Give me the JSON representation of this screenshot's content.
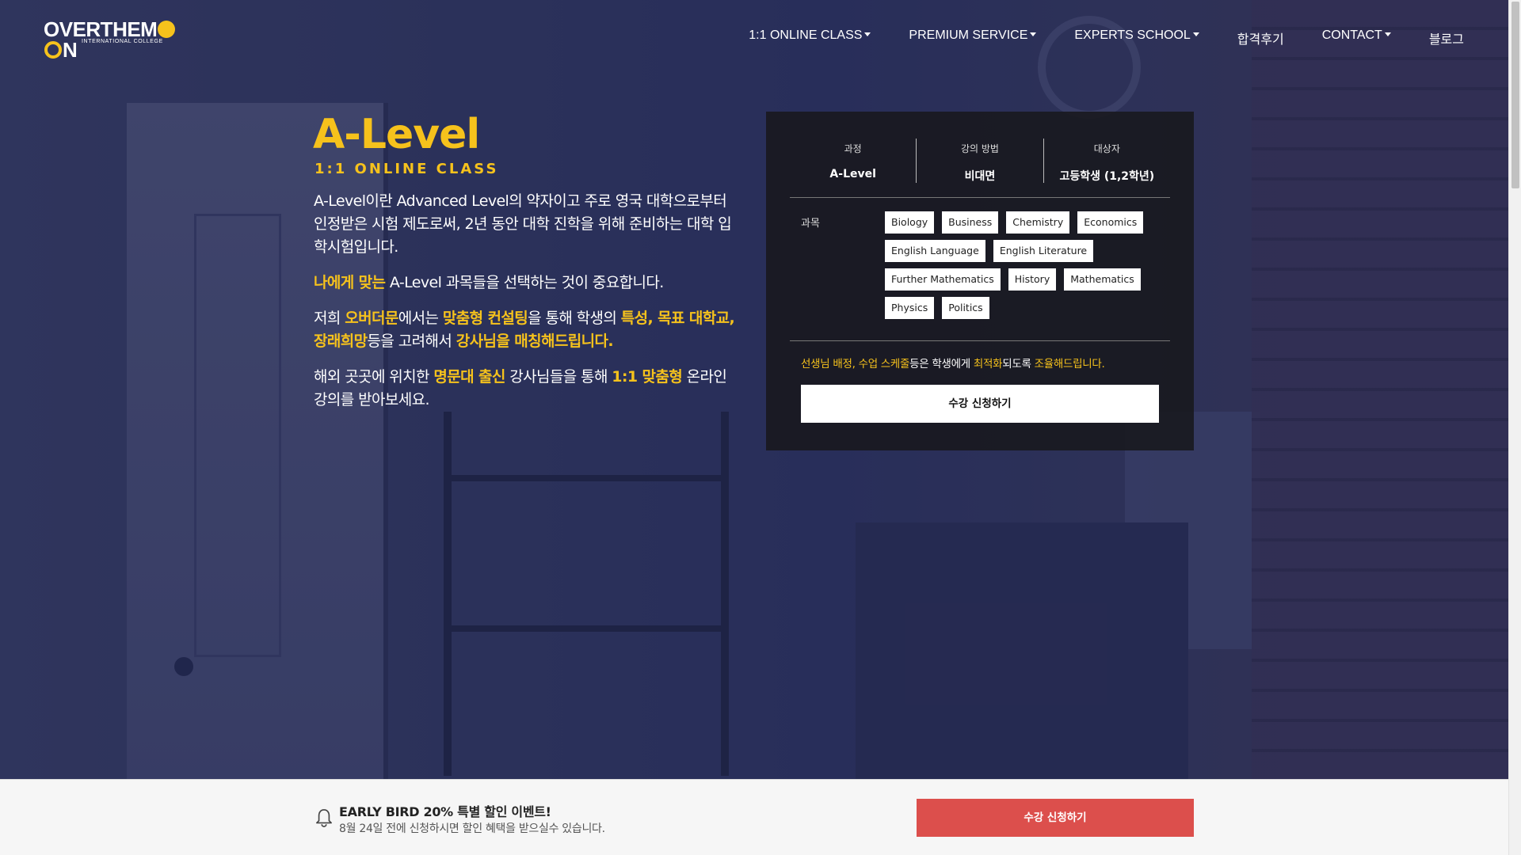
{
  "brand": {
    "logo_left": "OVERTHEM",
    "logo_right": "N",
    "logo_sub": "INTERNATIONAL COLLEGE"
  },
  "nav": {
    "items": [
      {
        "label": "1:1 ONLINE CLASS",
        "dropdown": true
      },
      {
        "label": "PREMIUM SERVICE",
        "dropdown": true
      },
      {
        "label": "EXPERTS SCHOOL",
        "dropdown": true
      },
      {
        "label": "합격후기",
        "dropdown": false
      },
      {
        "label": "CONTACT",
        "dropdown": true
      },
      {
        "label": "블로그",
        "dropdown": false
      }
    ]
  },
  "hero": {
    "title": "A-Level",
    "subtitle": "1:1 ONLINE CLASS",
    "p1": "A-Level이란 Advanced Level의 약자이고 주로 영국 대학으로부터 인정받은 시험 제도로써, 2년 동안 대학 진학을 위해 준비하는 대학 입학시험입니다.",
    "p2_hl": "나에게 맞는",
    "p2": " A-Level 과목들을 선택하는 것이 중요합니다.",
    "p3_a": "저희 ",
    "p3_b": "오버더문",
    "p3_c": "에서는 ",
    "p3_d": "맞춤형 컨설팅",
    "p3_e": "을 통해 학생의 ",
    "p3_f": "특성, 목표 대학교, 장래희망",
    "p3_g": "등을 고려해서 ",
    "p3_h": "강사님을 매칭해드립니다.",
    "p4_a": "해외 곳곳에 위치한 ",
    "p4_b": "명문대 출신",
    "p4_c": " 강사님들을 통해 ",
    "p4_d": "1:1 맞춤형",
    "p4_e": " 온라인 강의를 받아보세요."
  },
  "card": {
    "meta": [
      {
        "label": "과정",
        "value": "A-Level"
      },
      {
        "label": "강의 방법",
        "value": "비대면"
      },
      {
        "label": "대상자",
        "value": "고등학생 (1,2학년)"
      }
    ],
    "subjects_label": "과목",
    "subjects": [
      "Biology",
      "Business",
      "Chemistry",
      "Economics",
      "English Language",
      "English Literature",
      "Further Mathematics",
      "History",
      "Mathematics",
      "Physics",
      "Politics"
    ],
    "note_a": "선생님 배정, 수업 스케줄",
    "note_b": "등은 학생에게 ",
    "note_c": "최적화",
    "note_d": "되도록 ",
    "note_e": "조율해드립니다.",
    "apply_label": "수강 신청하기"
  },
  "promo": {
    "title": "EARLY BIRD 20% 특별 할인 이벤트!",
    "desc": "8월 24일 전에 신청하시면 할인 혜택을 받으실수 있습니다.",
    "apply_label": "수강 신청하기",
    "button_color": "#dc4f4c"
  },
  "colors": {
    "accent": "#f6c21c",
    "overlay": "#2c3054"
  },
  "icons": {
    "bell": "bell-icon",
    "caret": "caret-down-icon"
  }
}
